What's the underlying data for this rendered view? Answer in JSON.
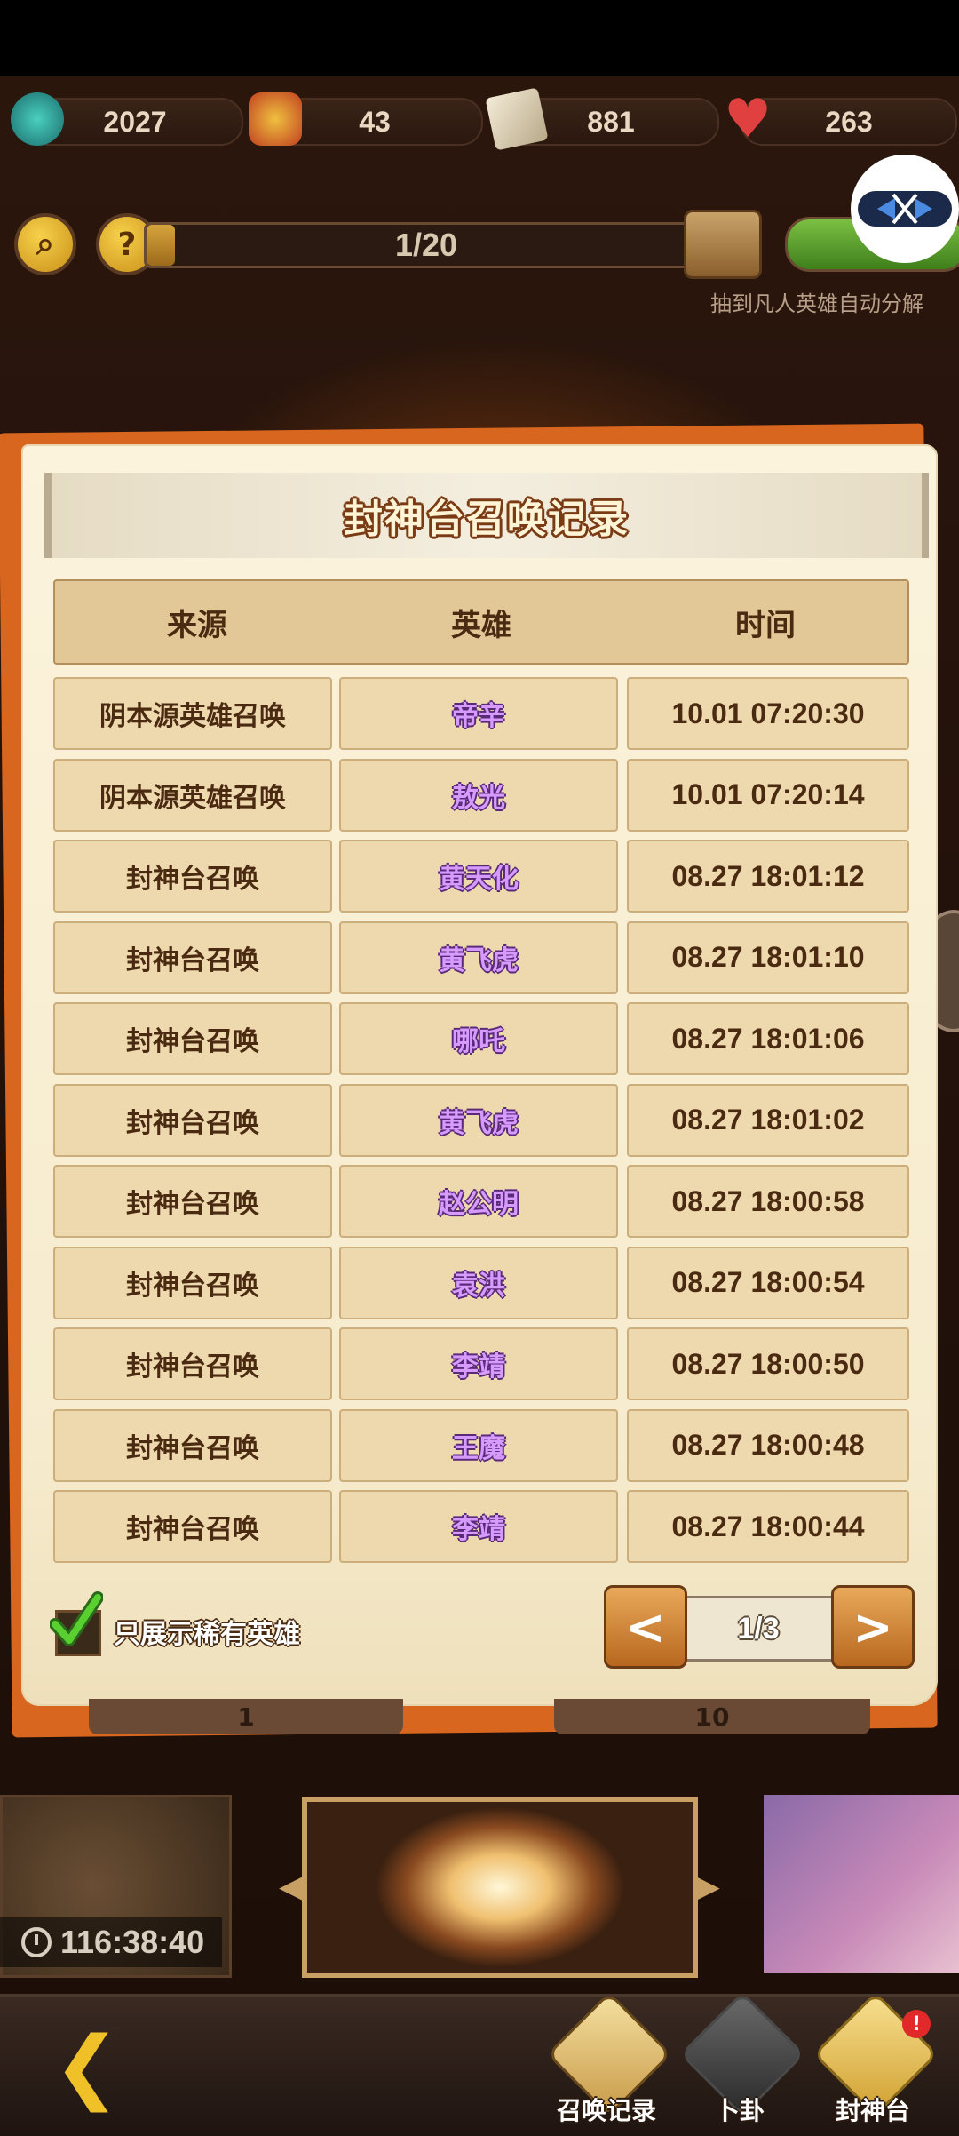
{
  "resources": [
    {
      "icon": "jade-coin-icon",
      "value": "2027"
    },
    {
      "icon": "character-token-icon",
      "value": "43"
    },
    {
      "icon": "scroll-ticket-icon",
      "value": "881"
    },
    {
      "icon": "heart-icon",
      "value": "263"
    }
  ],
  "progress": {
    "text": "1/20",
    "fraction": 0.05
  },
  "auto_decompose_text": "抽到凡人英雄自动分解",
  "modal": {
    "title": "封神台召唤记录",
    "headers": [
      "来源",
      "英雄",
      "时间"
    ],
    "rows": [
      {
        "source": "阴本源英雄召唤",
        "hero": "帝辛",
        "time": "10.01 07:20:30"
      },
      {
        "source": "阴本源英雄召唤",
        "hero": "敖光",
        "time": "10.01 07:20:14"
      },
      {
        "source": "封神台召唤",
        "hero": "黄天化",
        "time": "08.27 18:01:12"
      },
      {
        "source": "封神台召唤",
        "hero": "黄飞虎",
        "time": "08.27 18:01:10"
      },
      {
        "source": "封神台召唤",
        "hero": "哪吒",
        "time": "08.27 18:01:06"
      },
      {
        "source": "封神台召唤",
        "hero": "黄飞虎",
        "time": "08.27 18:01:02"
      },
      {
        "source": "封神台召唤",
        "hero": "赵公明",
        "time": "08.27 18:00:58"
      },
      {
        "source": "封神台召唤",
        "hero": "袁洪",
        "time": "08.27 18:00:54"
      },
      {
        "source": "封神台召唤",
        "hero": "李靖",
        "time": "08.27 18:00:50"
      },
      {
        "source": "封神台召唤",
        "hero": "王魔",
        "time": "08.27 18:00:48"
      },
      {
        "source": "封神台召唤",
        "hero": "李靖",
        "time": "08.27 18:00:44"
      }
    ],
    "rare_only_label": "只展示稀有英雄",
    "rare_only_checked": true,
    "pager": {
      "prev": "<",
      "text": "1/3",
      "next": ">"
    }
  },
  "under_tabs": [
    "1",
    "10"
  ],
  "timer": "116:38:40",
  "nav": [
    {
      "label": "召唤记录",
      "icon": "record-scroll-icon"
    },
    {
      "label": "卜卦",
      "icon": "yin-yang-icon"
    },
    {
      "label": "封神台",
      "icon": "altar-scroll-icon",
      "badge": "!"
    }
  ],
  "colors": {
    "accent_orange": "#d8661e",
    "hero_purple": "#b54de0",
    "parchment": "#f6ebcd"
  }
}
